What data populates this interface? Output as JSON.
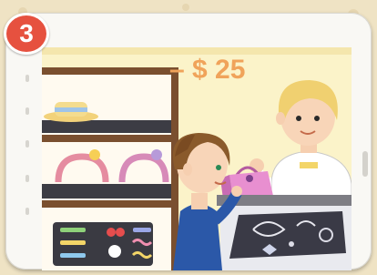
{
  "step": {
    "number": "3"
  },
  "scene": {
    "price_tag": "– $ 25"
  },
  "colors": {
    "badge": "#e6513f",
    "background": "#efe3c4",
    "tablet_frame": "#f9f8f4",
    "price": "#f0a35a"
  },
  "icons": {
    "shopkeeper": "shopkeeper-illustration",
    "customer": "customer-boy-illustration",
    "gift_bag": "gift-bag-icon"
  }
}
